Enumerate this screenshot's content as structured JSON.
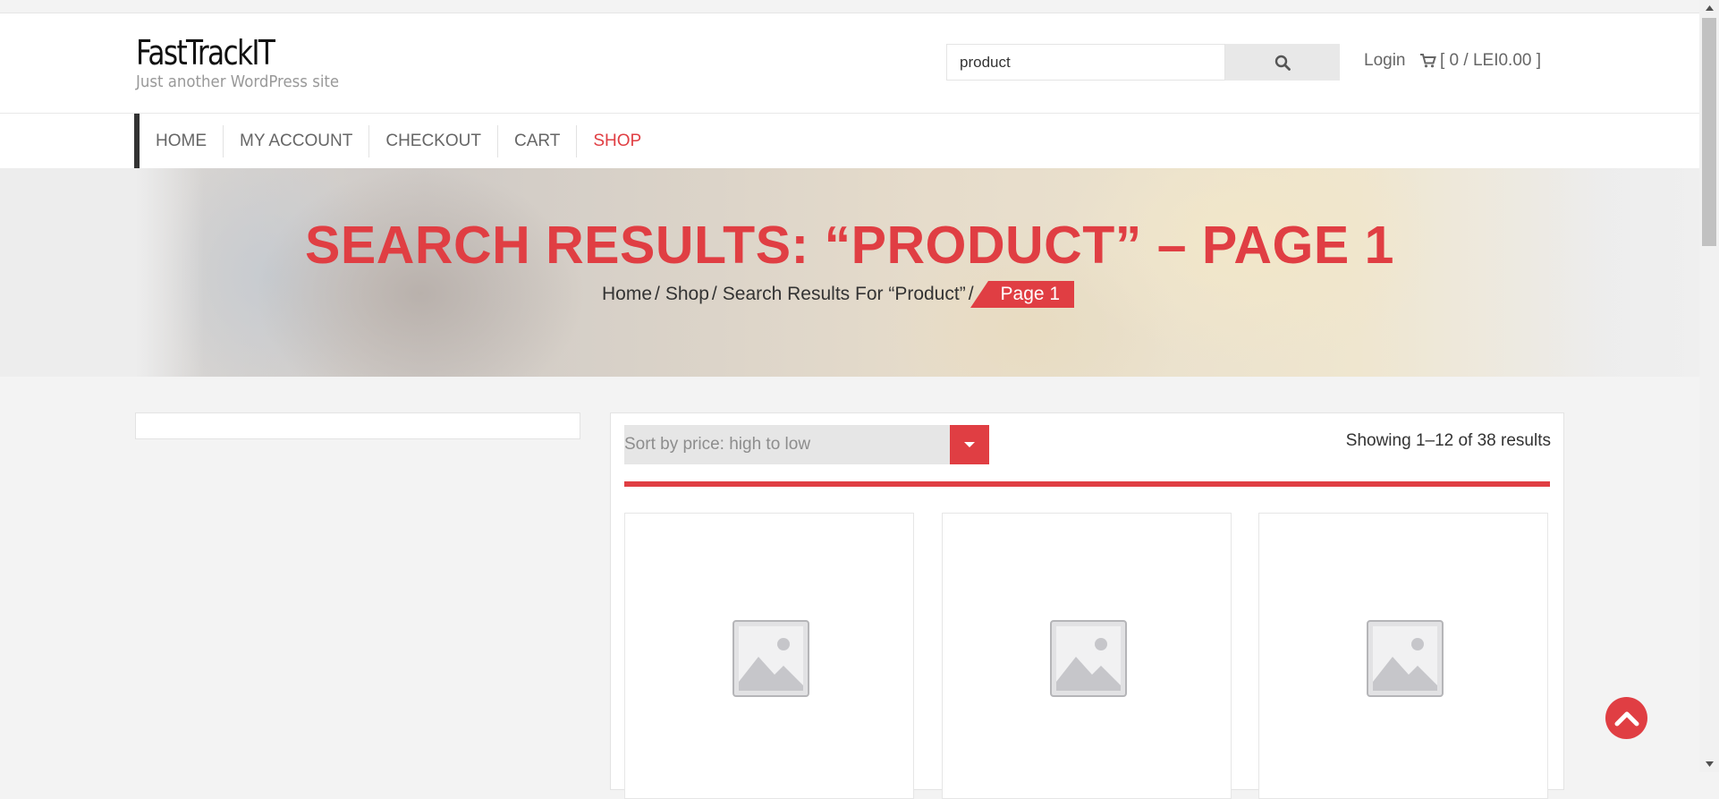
{
  "site": {
    "title": "FastTrackIT",
    "description": "Just another WordPress site"
  },
  "search": {
    "value": "product",
    "icon": "search-icon"
  },
  "account": {
    "login_label": "Login",
    "cart_label": "[ 0 / LEI0.00 ]",
    "cart_icon": "cart-icon"
  },
  "nav": {
    "items": [
      {
        "label": "HOME"
      },
      {
        "label": "MY ACCOUNT"
      },
      {
        "label": "CHECKOUT"
      },
      {
        "label": "CART"
      },
      {
        "label": "SHOP",
        "active": true
      }
    ]
  },
  "hero": {
    "title": "SEARCH RESULTS: “PRODUCT” – PAGE 1",
    "breadcrumb": {
      "items": [
        "Home",
        "Shop",
        "Search Results For “Product”"
      ],
      "separator": "/",
      "current": "Page 1"
    }
  },
  "shop": {
    "sort_selected": "Sort by price: high to low",
    "result_count": "Showing 1–12 of 38 results",
    "products": [
      {
        "image": "placeholder-image-icon"
      },
      {
        "image": "placeholder-image-icon"
      },
      {
        "image": "placeholder-image-icon"
      }
    ]
  },
  "colors": {
    "accent": "#e03e43",
    "background": "#f3f3f3",
    "text": "#333333"
  }
}
